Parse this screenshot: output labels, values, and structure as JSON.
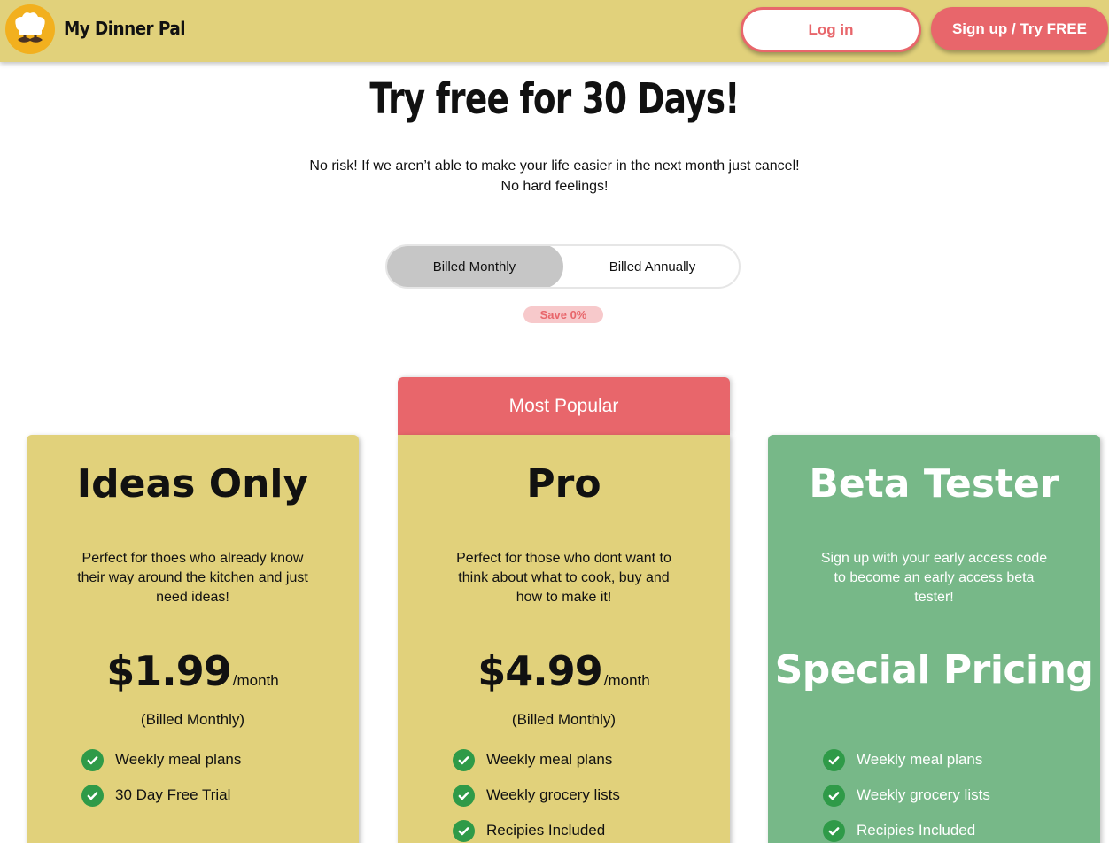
{
  "header": {
    "brand": "My Dinner Pal",
    "login_label": "Log in",
    "signup_label": "Sign up / Try FREE"
  },
  "hero": {
    "title": "Try free for 30 Days!",
    "subtitle_line1": "No risk! If we aren’t able to make your life easier in the next month just cancel!",
    "subtitle_line2": "No hard feelings!"
  },
  "billing": {
    "monthly_label": "Billed Monthly",
    "annual_label": "Billed Annually",
    "selected": "Billed Monthly",
    "save_badge": "Save 0%"
  },
  "colors": {
    "brand_yellow": "#e1d17b",
    "accent_red": "#e8666b",
    "beta_green": "#77b888",
    "check_green": "#2f9a48"
  },
  "plans": [
    {
      "name": "Ideas Only",
      "description": "Perfect for thoes who already know their way around the kitchen and just need ideas!",
      "price": "$1.99",
      "period": "/month",
      "billed": "(Billed Monthly)",
      "features": [
        "Weekly meal plans",
        "30 Day Free Trial"
      ]
    },
    {
      "badge": "Most Popular",
      "name": "Pro",
      "description": "Perfect for those who dont want to think about what to cook, buy and how to make it!",
      "price": "$4.99",
      "period": "/month",
      "billed": "(Billed Monthly)",
      "features": [
        "Weekly meal plans",
        "Weekly grocery lists",
        "Recipies Included"
      ]
    },
    {
      "name": "Beta Tester",
      "description": "Sign up with your early access code to become an early access beta tester!",
      "price": "Special Pricing",
      "features": [
        "Weekly meal plans",
        "Weekly grocery lists",
        "Recipies Included"
      ]
    }
  ]
}
